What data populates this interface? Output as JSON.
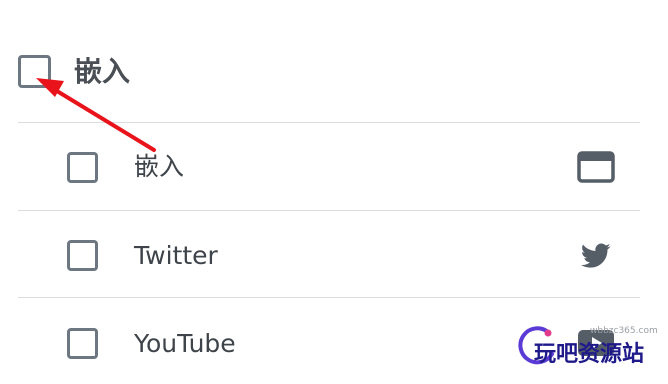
{
  "header": {
    "label": "嵌入",
    "checked": false
  },
  "rows": [
    {
      "label": "嵌入",
      "icon": "embed-window-icon",
      "checked": false
    },
    {
      "label": "Twitter",
      "icon": "twitter-bird-icon",
      "checked": false
    },
    {
      "label": "YouTube",
      "icon": "youtube-icon",
      "checked": false
    }
  ],
  "annotation": {
    "arrow_color": "#e8131b"
  },
  "watermark": {
    "url": "wbbzc365.com",
    "text": "玩吧资源站"
  },
  "colors": {
    "checkbox_border": "#6c7781",
    "text": "#3e444a",
    "icon": "#555d66",
    "divider": "#dadcde"
  }
}
